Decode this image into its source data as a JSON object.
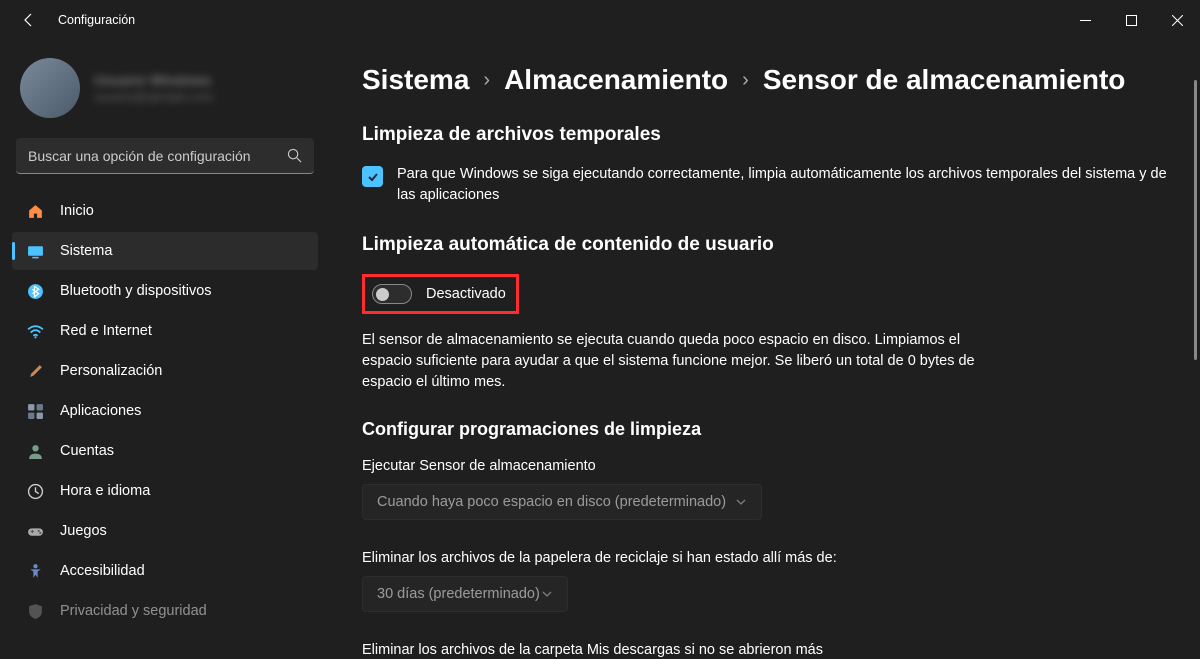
{
  "titlebar": {
    "title": "Configuración"
  },
  "profile": {
    "name": "Usuario Windows",
    "email": "usuario@ejemplo.com"
  },
  "search": {
    "placeholder": "Buscar una opción de configuración"
  },
  "sidebar": {
    "items": [
      {
        "label": "Inicio",
        "icon": "home",
        "color": "#ff8c42"
      },
      {
        "label": "Sistema",
        "icon": "system",
        "color": "#4cc2ff",
        "active": true
      },
      {
        "label": "Bluetooth y dispositivos",
        "icon": "bluetooth",
        "color": "#4cc2ff"
      },
      {
        "label": "Red e Internet",
        "icon": "wifi",
        "color": "#4cc2ff"
      },
      {
        "label": "Personalización",
        "icon": "brush",
        "color": "#c88a5a"
      },
      {
        "label": "Aplicaciones",
        "icon": "apps",
        "color": "#7a8a9a"
      },
      {
        "label": "Cuentas",
        "icon": "person",
        "color": "#7a9a8a"
      },
      {
        "label": "Hora e idioma",
        "icon": "clock",
        "color": "#aaaaaa"
      },
      {
        "label": "Juegos",
        "icon": "gamepad",
        "color": "#aaaaaa"
      },
      {
        "label": "Accesibilidad",
        "icon": "accessibility",
        "color": "#6a8aca"
      },
      {
        "label": "Privacidad y seguridad",
        "icon": "shield",
        "color": "#888"
      }
    ]
  },
  "breadcrumb": {
    "items": [
      "Sistema",
      "Almacenamiento"
    ],
    "current": "Sensor de almacenamiento"
  },
  "content": {
    "section1_title": "Limpieza de archivos temporales",
    "checkbox_label": "Para que Windows se siga ejecutando correctamente, limpia automáticamente los archivos temporales del sistema y de las aplicaciones",
    "section2_title": "Limpieza automática de contenido de usuario",
    "toggle_state": "Desactivado",
    "toggle_desc": "El sensor de almacenamiento se ejecuta cuando queda poco espacio en disco. Limpiamos el espacio suficiente para ayudar a que el sistema funcione mejor. Se liberó un total de 0 bytes de espacio el último mes.",
    "section3_title": "Configurar programaciones de limpieza",
    "dropdown1_label": "Ejecutar Sensor de almacenamiento",
    "dropdown1_value": "Cuando haya poco espacio en disco (predeterminado)",
    "dropdown2_label": "Eliminar los archivos de la papelera de reciclaje si han estado allí más de:",
    "dropdown2_value": "30 días (predeterminado)",
    "dropdown3_label": "Eliminar los archivos de la carpeta Mis descargas si no se abrieron más"
  }
}
